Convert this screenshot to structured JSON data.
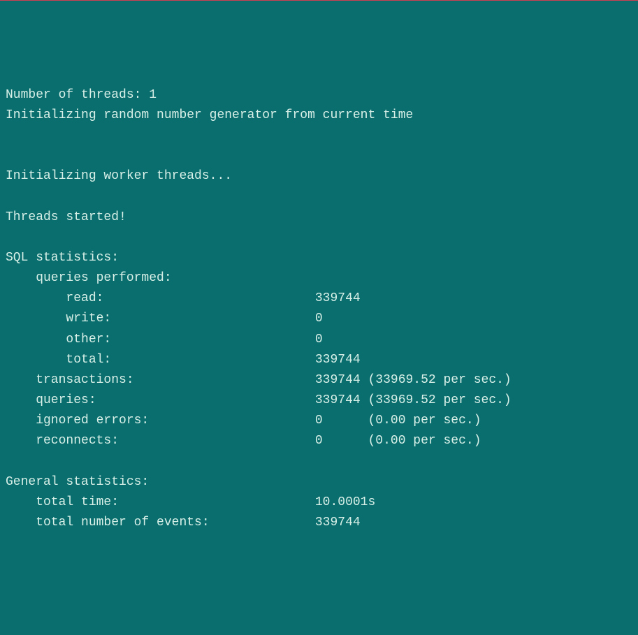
{
  "lines": {
    "l1": "Number of threads: 1",
    "l2": "Initializing random number generator from current time",
    "l3": "",
    "l4": "",
    "l5": "Initializing worker threads...",
    "l6": "",
    "l7": "Threads started!",
    "l8": "",
    "l9": "SQL statistics:",
    "l10": "    queries performed:",
    "l11": "        read:                            339744",
    "l12": "        write:                           0",
    "l13": "        other:                           0",
    "l14": "        total:                           339744",
    "l15": "    transactions:                        339744 (33969.52 per sec.)",
    "l16": "    queries:                             339744 (33969.52 per sec.)",
    "l17": "    ignored errors:                      0      (0.00 per sec.)",
    "l18": "    reconnects:                          0      (0.00 per sec.)",
    "l19": "",
    "l20": "General statistics:",
    "l21": "    total time:                          10.0001s",
    "l22": "    total number of events:              339744"
  }
}
